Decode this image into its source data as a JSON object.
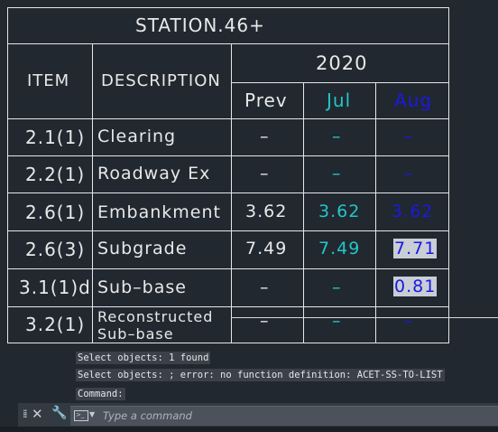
{
  "table": {
    "title": "STATION.46+",
    "header": {
      "item": "ITEM",
      "description": "DESCRIPTION",
      "year": "2020",
      "prev": "Prev",
      "jul": "Jul",
      "aug": "Aug"
    },
    "rows": [
      {
        "item": "2.1(1)",
        "description": "Clearing",
        "prev": "–",
        "jul": "–",
        "aug": "–"
      },
      {
        "item": "2.2(1)",
        "description": "Roadway Ex",
        "prev": "–",
        "jul": "–",
        "aug": "–"
      },
      {
        "item": "2.6(1)",
        "description": "Embankment",
        "prev": "3.62",
        "jul": "3.62",
        "aug": "3.62"
      },
      {
        "item": "2.6(3)",
        "description": "Subgrade",
        "prev": "7.49",
        "jul": "7.49",
        "aug": "7.71"
      },
      {
        "item": "3.1(1)d",
        "description": "Sub–base",
        "prev": "–",
        "jul": "–",
        "aug": "0.81"
      },
      {
        "item": "3.2(1)",
        "description_line1": "Reconstructed",
        "description_line2": "Sub–base",
        "prev": "–",
        "jul": "–",
        "aug": "–"
      }
    ],
    "colors": {
      "line": "#e6e6e6",
      "white": "#e8e8e8",
      "cyan": "#22c7c7",
      "blue": "#1a1ae0",
      "background": "#212830"
    }
  },
  "command_history": [
    "Select objects: 1 found",
    "Select objects:  ; error: no function definition: ACET-SS-TO-LIST",
    "Command:"
  ],
  "command_input": {
    "placeholder": "Type a command"
  },
  "icons": [
    "grip-icon",
    "close-icon",
    "customize-wrench-icon",
    "command-prompt-icon",
    "dropdown-arrow-icon"
  ]
}
